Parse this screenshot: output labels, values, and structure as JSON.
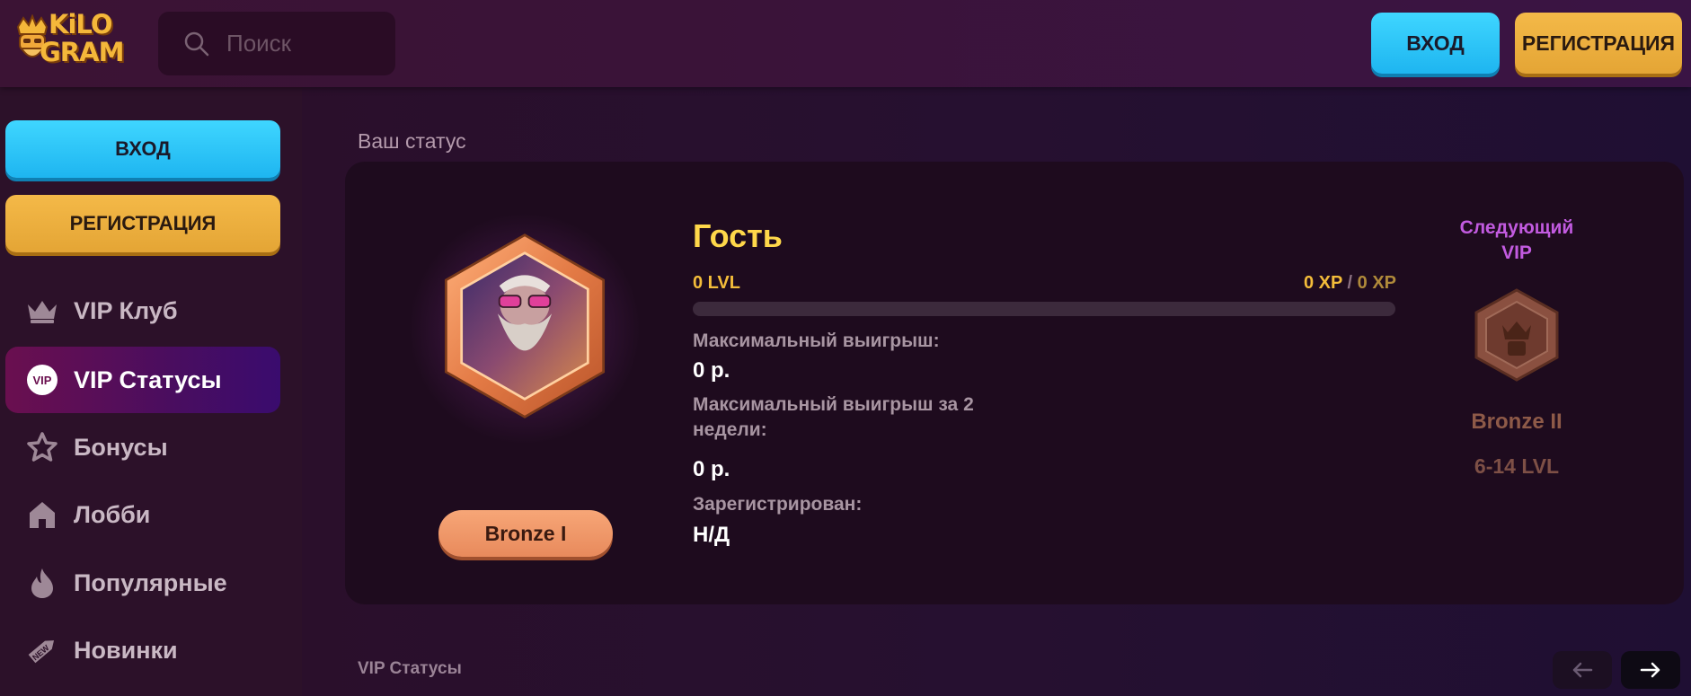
{
  "header": {
    "logo_line1": "KiLO",
    "logo_line2": "GRAM",
    "search_placeholder": "Поиск",
    "login_label": "ВХОД",
    "register_label": "РЕГИСТРАЦИЯ"
  },
  "sidebar": {
    "login_label": "ВХОД",
    "register_label": "РЕГИСТРАЦИЯ",
    "items": [
      {
        "label": "VIP Клуб",
        "icon": "crown-icon"
      },
      {
        "label": "VIP Статусы",
        "icon": "vip-badge-icon",
        "active": true
      },
      {
        "label": "Бонусы",
        "icon": "star-icon"
      },
      {
        "label": "Лобби",
        "icon": "home-icon"
      },
      {
        "label": "Популярные",
        "icon": "flame-icon"
      },
      {
        "label": "Новинки",
        "icon": "new-tag-icon"
      }
    ]
  },
  "main": {
    "section_title": "Ваш статус",
    "status_card": {
      "name": "Гость",
      "level": "0 LVL",
      "xp_current": "0 XP",
      "xp_separator": "/",
      "xp_max": "0 XP",
      "progress_fraction": 0,
      "rank": "Bronze I",
      "stats": [
        {
          "label": "Максимальный выигрыш:",
          "value": "0 р."
        },
        {
          "label": "Максимальный выигрыш за 2 недели:",
          "value": "0 р."
        },
        {
          "label": "Зарегистрирован:",
          "value": "Н/Д"
        }
      ],
      "next": {
        "title": "Следующий VIP",
        "rank": "Bronze II",
        "levels": "6-14 LVL"
      }
    },
    "bottom_title": "VIP Статусы"
  },
  "colors": {
    "accent_blue": "#1eb5f0",
    "accent_gold": "#e4a535",
    "bronze": "#e88a5c",
    "guest_yellow": "#ffd84a",
    "next_purple": "#c25be0"
  }
}
